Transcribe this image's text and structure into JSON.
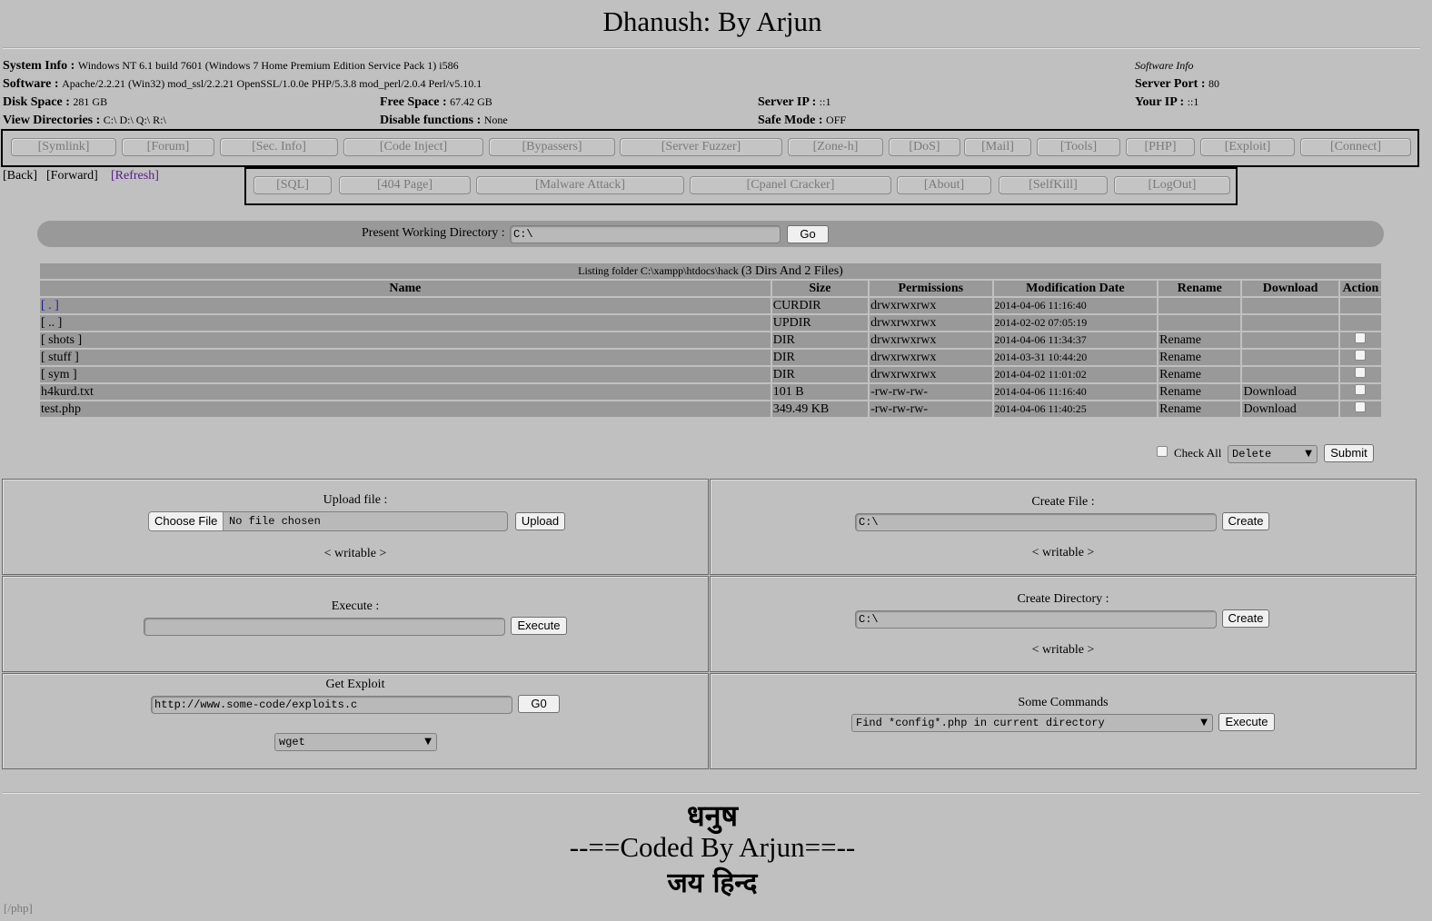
{
  "title": "Dhanush: By Arjun",
  "info": {
    "system_label": "System Info :",
    "system_value": "Windows NT 6.1 build 7601 (Windows 7 Home Premium Edition Service Pack 1) i586",
    "software_label": "Software :",
    "software_value": "Apache/2.2.21 (Win32) mod_ssl/2.2.21 OpenSSL/1.0.0e PHP/5.3.8 mod_perl/2.0.4 Perl/v5.10.1",
    "software_info_link": "Software Info",
    "server_port_label": "Server Port :",
    "server_port_value": "80",
    "disk_label": "Disk Space :",
    "disk_value": "281 GB",
    "free_label": "Free Space :",
    "free_value": "67.42 GB",
    "server_ip_label": "Server IP :",
    "server_ip_value": "::1",
    "your_ip_label": "Your IP :",
    "your_ip_value": "::1",
    "dirs_label": "View Directories :",
    "dirs_value": "C:\\ D:\\ Q:\\ R:\\",
    "disable_label": "Disable functions :",
    "disable_value": "None",
    "safe_label": "Safe Mode :",
    "safe_value": "OFF"
  },
  "nav1": [
    "[Symlink]",
    "[Forum]",
    "[Sec. Info]",
    "[Code Inject]",
    "[Bypassers]",
    "[Server Fuzzer]",
    "[Zone-h]",
    "[DoS]",
    "[Mail]",
    "[Tools]",
    "[PHP]",
    "[Exploit]",
    "[Connect]"
  ],
  "nav2": [
    "[SQL]",
    "[404 Page]",
    "[Malware Attack]",
    "[Cpanel Cracker]",
    "[About]",
    "[SelfKill]",
    "[LogOut]"
  ],
  "history": {
    "back": "[Back]",
    "forward": "[Forward]",
    "refresh": "[Refresh]"
  },
  "pwd": {
    "label": "Present Working Directory :",
    "value": "C:\\",
    "go": "Go"
  },
  "listing": {
    "caption_prefix": "Listing folder C:\\xampp\\htdocs\\hack",
    "caption_suffix": "(3 Dirs And 2 Files)",
    "headers": [
      "Name",
      "Size",
      "Permissions",
      "Modification Date",
      "Rename",
      "Download",
      "Action"
    ],
    "rows": [
      {
        "name": "[ . ]",
        "size": "CURDIR",
        "perm": "drwxrwxrwx",
        "date": "2014-04-06 11:16:40",
        "rename": "",
        "download": "",
        "check": false,
        "link": true
      },
      {
        "name": "[ .. ]",
        "size": "UPDIR",
        "perm": "drwxrwxrwx",
        "date": "2014-02-02 07:05:19",
        "rename": "",
        "download": "",
        "check": false,
        "link": false
      },
      {
        "name": "[ shots ]",
        "size": "DIR",
        "perm": "drwxrwxrwx",
        "date": "2014-04-06 11:34:37",
        "rename": "Rename",
        "download": "",
        "check": true,
        "link": false
      },
      {
        "name": "[ stuff ]",
        "size": "DIR",
        "perm": "drwxrwxrwx",
        "date": "2014-03-31 10:44:20",
        "rename": "Rename",
        "download": "",
        "check": true,
        "link": false
      },
      {
        "name": "[ sym ]",
        "size": "DIR",
        "perm": "drwxrwxrwx",
        "date": "2014-04-02 11:01:02",
        "rename": "Rename",
        "download": "",
        "check": true,
        "link": false
      },
      {
        "name": "h4kurd.txt",
        "size": "101 B",
        "perm": "-rw-rw-rw-",
        "date": "2014-04-06 11:16:40",
        "rename": "Rename",
        "download": "Download",
        "check": true,
        "link": false
      },
      {
        "name": "test.php",
        "size": "349.49 KB",
        "perm": "-rw-rw-rw-",
        "date": "2014-04-06 11:40:25",
        "rename": "Rename",
        "download": "Download",
        "check": true,
        "link": false
      }
    ]
  },
  "bulk": {
    "check_all": "Check All",
    "action": "Delete",
    "submit": "Submit"
  },
  "upload": {
    "title": "Upload file :",
    "choose": "Choose File",
    "no_file": "No file chosen",
    "button": "Upload",
    "writable": "< writable >"
  },
  "create_file": {
    "title": "Create File :",
    "value": "C:\\",
    "button": "Create",
    "writable": "< writable >"
  },
  "execute": {
    "title": "Execute :",
    "value": "",
    "button": "Execute"
  },
  "create_dir": {
    "title": "Create Directory :",
    "value": "C:\\",
    "button": "Create",
    "writable": "< writable >"
  },
  "exploit": {
    "title": "Get Exploit",
    "value": "http://www.some-code/exploits.c",
    "button": "G0",
    "method": "wget"
  },
  "commands": {
    "title": "Some Commands",
    "selected": "Find *config*.php in current directory",
    "button": "Execute"
  },
  "footer": {
    "line1": "धनुष",
    "line2": "--==Coded By Arjun==--",
    "line3": "जय हिन्द",
    "path": "[/php]"
  },
  "colors": {
    "background": "#c0c0c0",
    "panel": "#999999",
    "link": "#1a1aa6",
    "visited": "#551a8b",
    "muted": "#7a7a7a"
  }
}
